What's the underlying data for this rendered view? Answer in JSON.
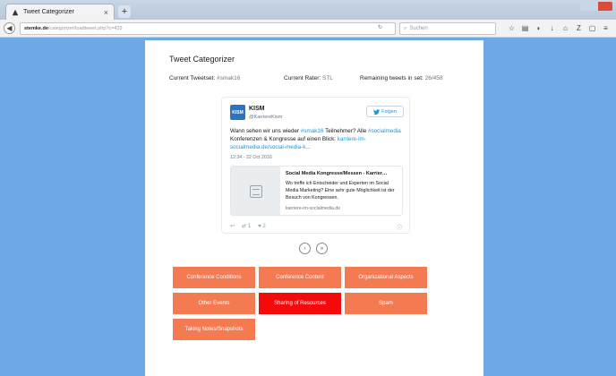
{
  "browser": {
    "tab_title": "Tweet Categorizer",
    "tab_close": "×",
    "new_tab": "+",
    "url_host": "stemke.de",
    "url_path": "/categorizer/loadtweet.php?c=433",
    "search_placeholder": "Suchen"
  },
  "page": {
    "title": "Tweet Categorizer",
    "tweetset_label": "Current Tweetset:",
    "tweetset_value": "#smak16",
    "rater_label": "Current Rater:",
    "rater_value": "STL",
    "remaining_label": "Remaining tweets in set:",
    "remaining_value": "26/458"
  },
  "tweet": {
    "avatar_text": "KISM",
    "name": "KISM",
    "handle": "@KarriereKism",
    "follow_label": "Folgen",
    "text_1": "Wann sehen wir uns wieder ",
    "tag_1": "#smak16",
    "text_2": " Teilnehmer? Alle ",
    "tag_2": "#socialmedia",
    "text_3": " Konferenzen & Kongresse auf einen Blick: ",
    "link": "karriere-im-socialmedia.de/social-media-k…",
    "timestamp": "12:34 - 22 Oct 2016",
    "preview_title": "Social Media Kongresse/Messen - Karrier…",
    "preview_desc": "Wo treffe ich Entscheider und Experten im Social Media Marketing? Eine sehr gute Möglichkeit ist der Besuch von Kongressen.",
    "preview_domain": "karriere-im-socialmedia.de",
    "retweet_count": "1",
    "like_count": "2"
  },
  "pager": {
    "prev": "‹",
    "next": "»"
  },
  "categories": [
    {
      "label": "Conference Conditions",
      "selected": false
    },
    {
      "label": "Conference Content",
      "selected": false
    },
    {
      "label": "Organizational Aspects",
      "selected": false
    },
    {
      "label": "Other Events",
      "selected": false
    },
    {
      "label": "Sharing of Resources",
      "selected": true
    },
    {
      "label": "Spam",
      "selected": false
    },
    {
      "label": "Taking Notes/Snapshots",
      "selected": false
    }
  ],
  "colors": {
    "category": "#f47a52",
    "category_selected": "#f40a0a",
    "background": "#6ea8e6",
    "link": "#1b95e0"
  }
}
